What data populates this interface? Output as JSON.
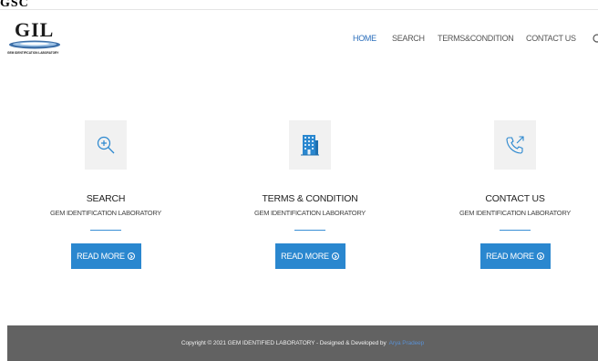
{
  "header_fragment": "GSC",
  "logo": {
    "text": "GIL",
    "subtitle": "GEM IDENTIFICATION LABORATORY"
  },
  "nav": {
    "items": [
      {
        "label": "Home",
        "active": true
      },
      {
        "label": "Search",
        "active": false
      },
      {
        "label": "Terms&Condition",
        "active": false
      },
      {
        "label": "Contact Us",
        "active": false
      }
    ],
    "icon": "search-icon"
  },
  "cards": [
    {
      "icon": "magnifier-plus-icon",
      "title": "Search",
      "subtitle": "Gem Identification Laboratory",
      "button": "Read More"
    },
    {
      "icon": "building-icon",
      "title": "Terms & Condition",
      "subtitle": "Gem Identification Laboratory",
      "button": "Read More"
    },
    {
      "icon": "phone-outgoing-icon",
      "title": "Contact Us",
      "subtitle": "Gem Identification Laboratory",
      "button": "Read More"
    }
  ],
  "footer": {
    "text": "Copyright © 2021 GEM IDENTIFIED LABORATORY - Designed & Developed by",
    "link": "Arya Pradeep"
  },
  "colors": {
    "accent": "#2a87cf",
    "nav_active": "#2a6ebb",
    "footer_bg": "#626262"
  }
}
